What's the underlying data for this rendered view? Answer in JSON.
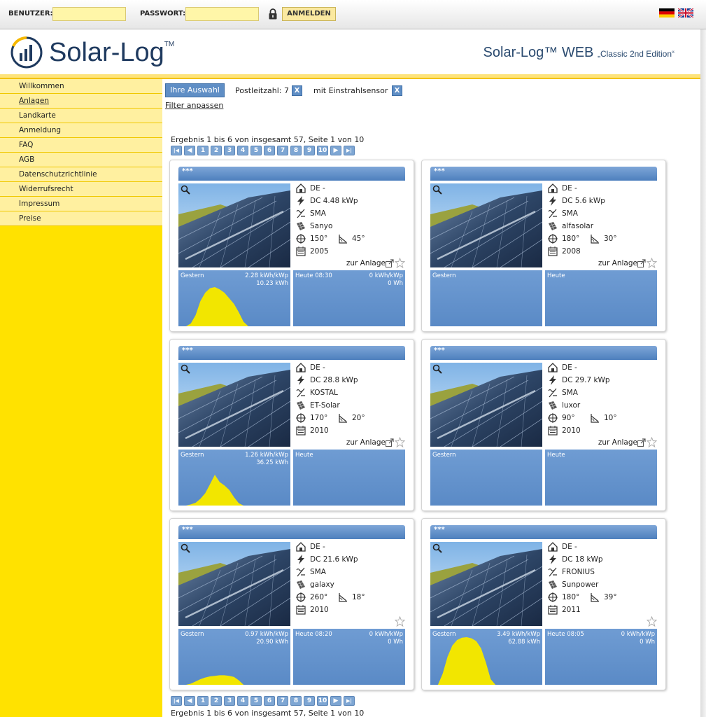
{
  "topbar": {
    "user_label": "BENUTZER:",
    "password_label": "PASSWORT:",
    "login_button": "ANMELDEN",
    "flags": [
      "de-flag-icon",
      "uk-flag-icon"
    ]
  },
  "header": {
    "logo_text": "Solar-Log",
    "logo_tm": "TM",
    "title": "Solar-Log™ WEB",
    "subtitle": "„Classic 2nd Edition“"
  },
  "sidebar": {
    "items": [
      {
        "label": "Willkommen"
      },
      {
        "label": "Anlagen"
      },
      {
        "label": "Landkarte"
      },
      {
        "label": "Anmeldung"
      },
      {
        "label": "FAQ"
      },
      {
        "label": "AGB"
      },
      {
        "label": "Datenschutzrichtlinie"
      },
      {
        "label": "Widerrufsrecht"
      },
      {
        "label": "Impressum"
      },
      {
        "label": "Preise"
      }
    ]
  },
  "filters": {
    "selection_button": "Ihre Auswahl",
    "postcode": "Postleitzahl: 7",
    "sensor": "mit Einstrahlsensor",
    "remove_label": "X",
    "adjust_link": "Filter anpassen"
  },
  "result_text": "Ergebnis 1 bis 6 von insgesamt 57, Seite 1 von 10",
  "pagination": {
    "pages": [
      "1",
      "2",
      "3",
      "4",
      "5",
      "6",
      "7",
      "8",
      "9",
      "10"
    ],
    "first": "|◀",
    "prev": "◀",
    "next": "▶",
    "last": "▶|"
  },
  "colors": {
    "sidebar_yellow": "#ffe200",
    "panel_blue": "#6f9cd3",
    "curve_yellow": "#f2e600"
  },
  "plants": [
    {
      "title": "***",
      "country": "DE -",
      "power": "DC 4.48 kWp",
      "inverter": "SMA",
      "module": "Sanyo",
      "azimuth": "150°",
      "tilt": "45°",
      "year": "2005",
      "link": "zur Anlage",
      "yesterday": {
        "label": "Gestern",
        "yield_specific": "2.28 kWh/kWp",
        "yield_total": "10.23 kWh"
      },
      "today": {
        "label": "Heute 08:30",
        "yield_specific": "0 kWh/kWp",
        "yield_total": "0 Wh"
      },
      "yesterday_curve": [
        0,
        0,
        0.05,
        0.2,
        0.45,
        0.6,
        0.68,
        0.7,
        0.66,
        0.6,
        0.5,
        0.4,
        0.25,
        0.08,
        0
      ]
    },
    {
      "title": "***",
      "country": "DE -",
      "power": "DC 5.6 kWp",
      "inverter": "SMA",
      "module": "alfasolar",
      "azimuth": "180°",
      "tilt": "30°",
      "year": "2008",
      "link": "zur Anlage",
      "yesterday": {
        "label": "Gestern",
        "yield_specific": "",
        "yield_total": ""
      },
      "today": {
        "label": "Heute",
        "yield_specific": "",
        "yield_total": ""
      },
      "yesterday_curve": []
    },
    {
      "title": "***",
      "country": "DE -",
      "power": "DC 28.8 kWp",
      "inverter": "KOSTAL",
      "module": "ET-Solar",
      "azimuth": "170°",
      "tilt": "20°",
      "year": "2010",
      "link": "zur Anlage",
      "yesterday": {
        "label": "Gestern",
        "yield_specific": "1.26 kWh/kWp",
        "yield_total": "36.25 kWh"
      },
      "today": {
        "label": "Heute",
        "yield_specific": "",
        "yield_total": ""
      },
      "yesterday_curve": [
        0,
        0,
        0.02,
        0.05,
        0.12,
        0.22,
        0.38,
        0.55,
        0.42,
        0.36,
        0.28,
        0.15,
        0.04,
        0,
        0
      ]
    },
    {
      "title": "***",
      "country": "DE -",
      "power": "DC 29.7 kWp",
      "inverter": "SMA",
      "module": "luxor",
      "azimuth": "90°",
      "tilt": "10°",
      "year": "2010",
      "link": "zur Anlage",
      "yesterday": {
        "label": "Gestern",
        "yield_specific": "",
        "yield_total": ""
      },
      "today": {
        "label": "Heute",
        "yield_specific": "",
        "yield_total": ""
      },
      "yesterday_curve": []
    },
    {
      "title": "***",
      "country": "DE -",
      "power": "DC 21.6 kWp",
      "inverter": "SMA",
      "module": "galaxy",
      "azimuth": "260°",
      "tilt": "18°",
      "year": "2010",
      "link": "",
      "yesterday": {
        "label": "Gestern",
        "yield_specific": "0.97 kWh/kWp",
        "yield_total": "20.90 kWh"
      },
      "today": {
        "label": "Heute 08:20",
        "yield_specific": "0 kWh/kWp",
        "yield_total": "0 Wh"
      },
      "yesterday_curve": [
        0,
        0,
        0.02,
        0.06,
        0.1,
        0.13,
        0.15,
        0.16,
        0.17,
        0.17,
        0.16,
        0.14,
        0.08,
        0,
        0
      ]
    },
    {
      "title": "***",
      "country": "DE -",
      "power": "DC 18 kWp",
      "inverter": "FRONIUS",
      "module": "Sunpower",
      "azimuth": "180°",
      "tilt": "39°",
      "year": "2011",
      "link": "",
      "yesterday": {
        "label": "Gestern",
        "yield_specific": "3.49 kWh/kWp",
        "yield_total": "62.88 kWh"
      },
      "today": {
        "label": "Heute 08:05",
        "yield_specific": "0 kWh/kWp",
        "yield_total": "0 Wh"
      },
      "yesterday_curve": [
        0,
        0,
        0.2,
        0.5,
        0.7,
        0.8,
        0.84,
        0.85,
        0.83,
        0.78,
        0.65,
        0.4,
        0.1,
        0,
        0
      ]
    }
  ]
}
